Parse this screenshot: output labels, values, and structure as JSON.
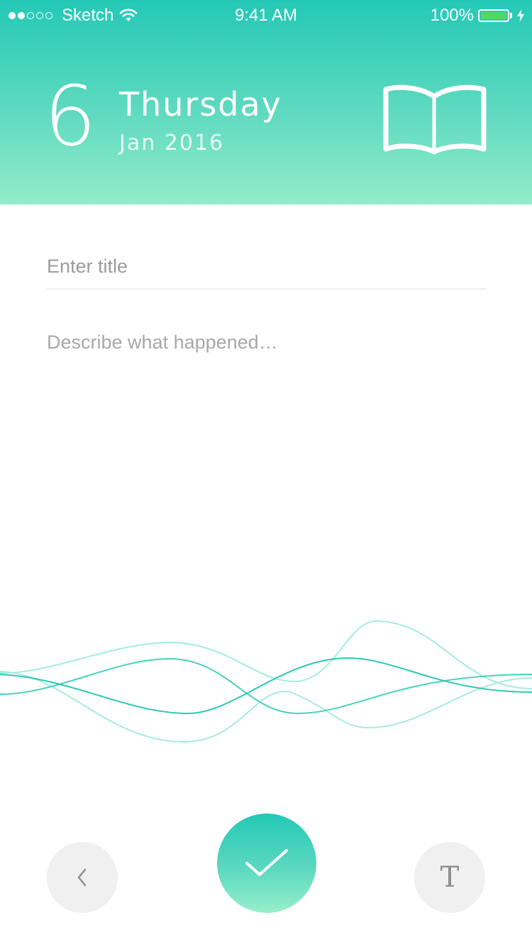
{
  "status_bar": {
    "carrier": "Sketch",
    "time": "9:41 AM",
    "battery": "100%",
    "signal_bars_filled": 2,
    "signal_bars_total": 5
  },
  "header": {
    "date_number": "6",
    "weekday": "Thursday",
    "month_year": "Jan 2016",
    "journal_icon": "open-book-icon"
  },
  "form": {
    "title_placeholder": "Enter title",
    "description_placeholder": "Describe what happened…"
  },
  "toolbar": {
    "back_icon": "chevron-left-icon",
    "confirm_icon": "checkmark-icon",
    "text_format_label": "T"
  },
  "colors": {
    "accent": "#24c9b6",
    "accent_light": "#93ecc9",
    "wave_dark": "#2bc8b3",
    "wave_light": "#a6ecdf",
    "button_gray": "#f0f0f0",
    "battery_green": "#4cd964"
  }
}
